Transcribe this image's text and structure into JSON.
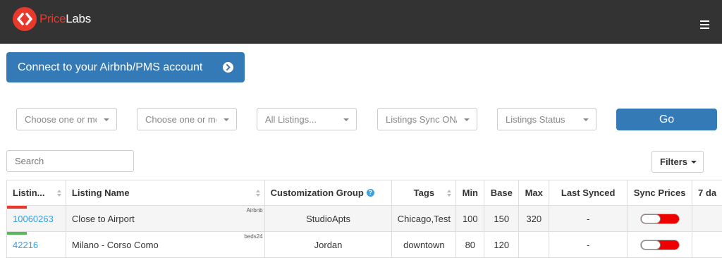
{
  "brand": {
    "price": "Price",
    "labs": "Labs",
    "accent": "#e8392c"
  },
  "connect_button": {
    "label": "Connect to your Airbnb/PMS account"
  },
  "filters": {
    "select1": "Choose one or mo",
    "select2": "Choose one or mo",
    "select3": "All Listings...",
    "select4": "Listings Sync ON/O",
    "select5": "Listings Status",
    "go_label": "Go"
  },
  "search": {
    "placeholder": "Search"
  },
  "filters_button": {
    "label": "Filters"
  },
  "table": {
    "headers": [
      "Listin...",
      "Listing Name",
      "Customization Group",
      "Tags",
      "Min",
      "Base",
      "Max",
      "Last Synced",
      "Sync Prices",
      "7 da"
    ],
    "rows": [
      {
        "id": "10060263",
        "name": "Close to Airport",
        "source": "Airbnb",
        "group": "StudioApts",
        "tags": "Chicago,Test",
        "min": "100",
        "base": "150",
        "max": "320",
        "last_synced": "-",
        "sync_prices": "off",
        "status_color": "#e8392c"
      },
      {
        "id": "42216",
        "name": "Milano - Corso Como",
        "source": "beds24",
        "group": "Jordan",
        "tags": "downtown",
        "min": "80",
        "base": "120",
        "max": "",
        "last_synced": "-",
        "sync_prices": "off",
        "status_color": "#5cb85c"
      }
    ]
  }
}
